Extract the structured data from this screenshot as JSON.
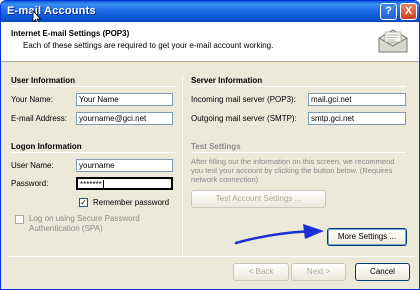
{
  "window": {
    "title": "E-mail Accounts",
    "help_glyph": "?",
    "close_glyph": "X"
  },
  "header": {
    "title": "Internet E-mail Settings (POP3)",
    "subtitle": "Each of these settings are required to get your e-mail account working."
  },
  "user_info": {
    "heading": "User Information",
    "name_label": "Your Name:",
    "name_value": "Your Name",
    "email_label": "E-mail Address:",
    "email_value": "yourname@gci.net"
  },
  "server_info": {
    "heading": "Server Information",
    "incoming_label": "Incoming mail server (POP3):",
    "incoming_value": "mail.gci.net",
    "outgoing_label": "Outgoing mail server (SMTP):",
    "outgoing_value": "smtp.gci.net"
  },
  "logon_info": {
    "heading": "Logon Information",
    "username_label": "User Name:",
    "username_value": "yourname",
    "password_label": "Password:",
    "password_value": "*******",
    "remember_label": "Remember password",
    "remember_checked": true,
    "spa_label_line1": "Log on using Secure Password",
    "spa_label_line2": "Authentication (SPA)",
    "spa_checked": false
  },
  "test_settings": {
    "heading": "Test Settings",
    "note": "After filling out the information on this screen, we recommend you test your account by clicking the button below. (Requires network connection)",
    "test_button": "Test Account Settings ...",
    "check_mark": "✓"
  },
  "buttons": {
    "more_settings": "More Settings ...",
    "back": "< Back",
    "next": "Next >",
    "cancel": "Cancel"
  },
  "colors": {
    "titlebar": "#0a5fd8",
    "dialog_bg": "#ece9d8",
    "annotation_arrow": "#1a2fd6"
  },
  "icons": {
    "header": "envelope-icon",
    "cursor": "mouse-cursor-icon",
    "annotation": "blue-arrow-annotation"
  }
}
